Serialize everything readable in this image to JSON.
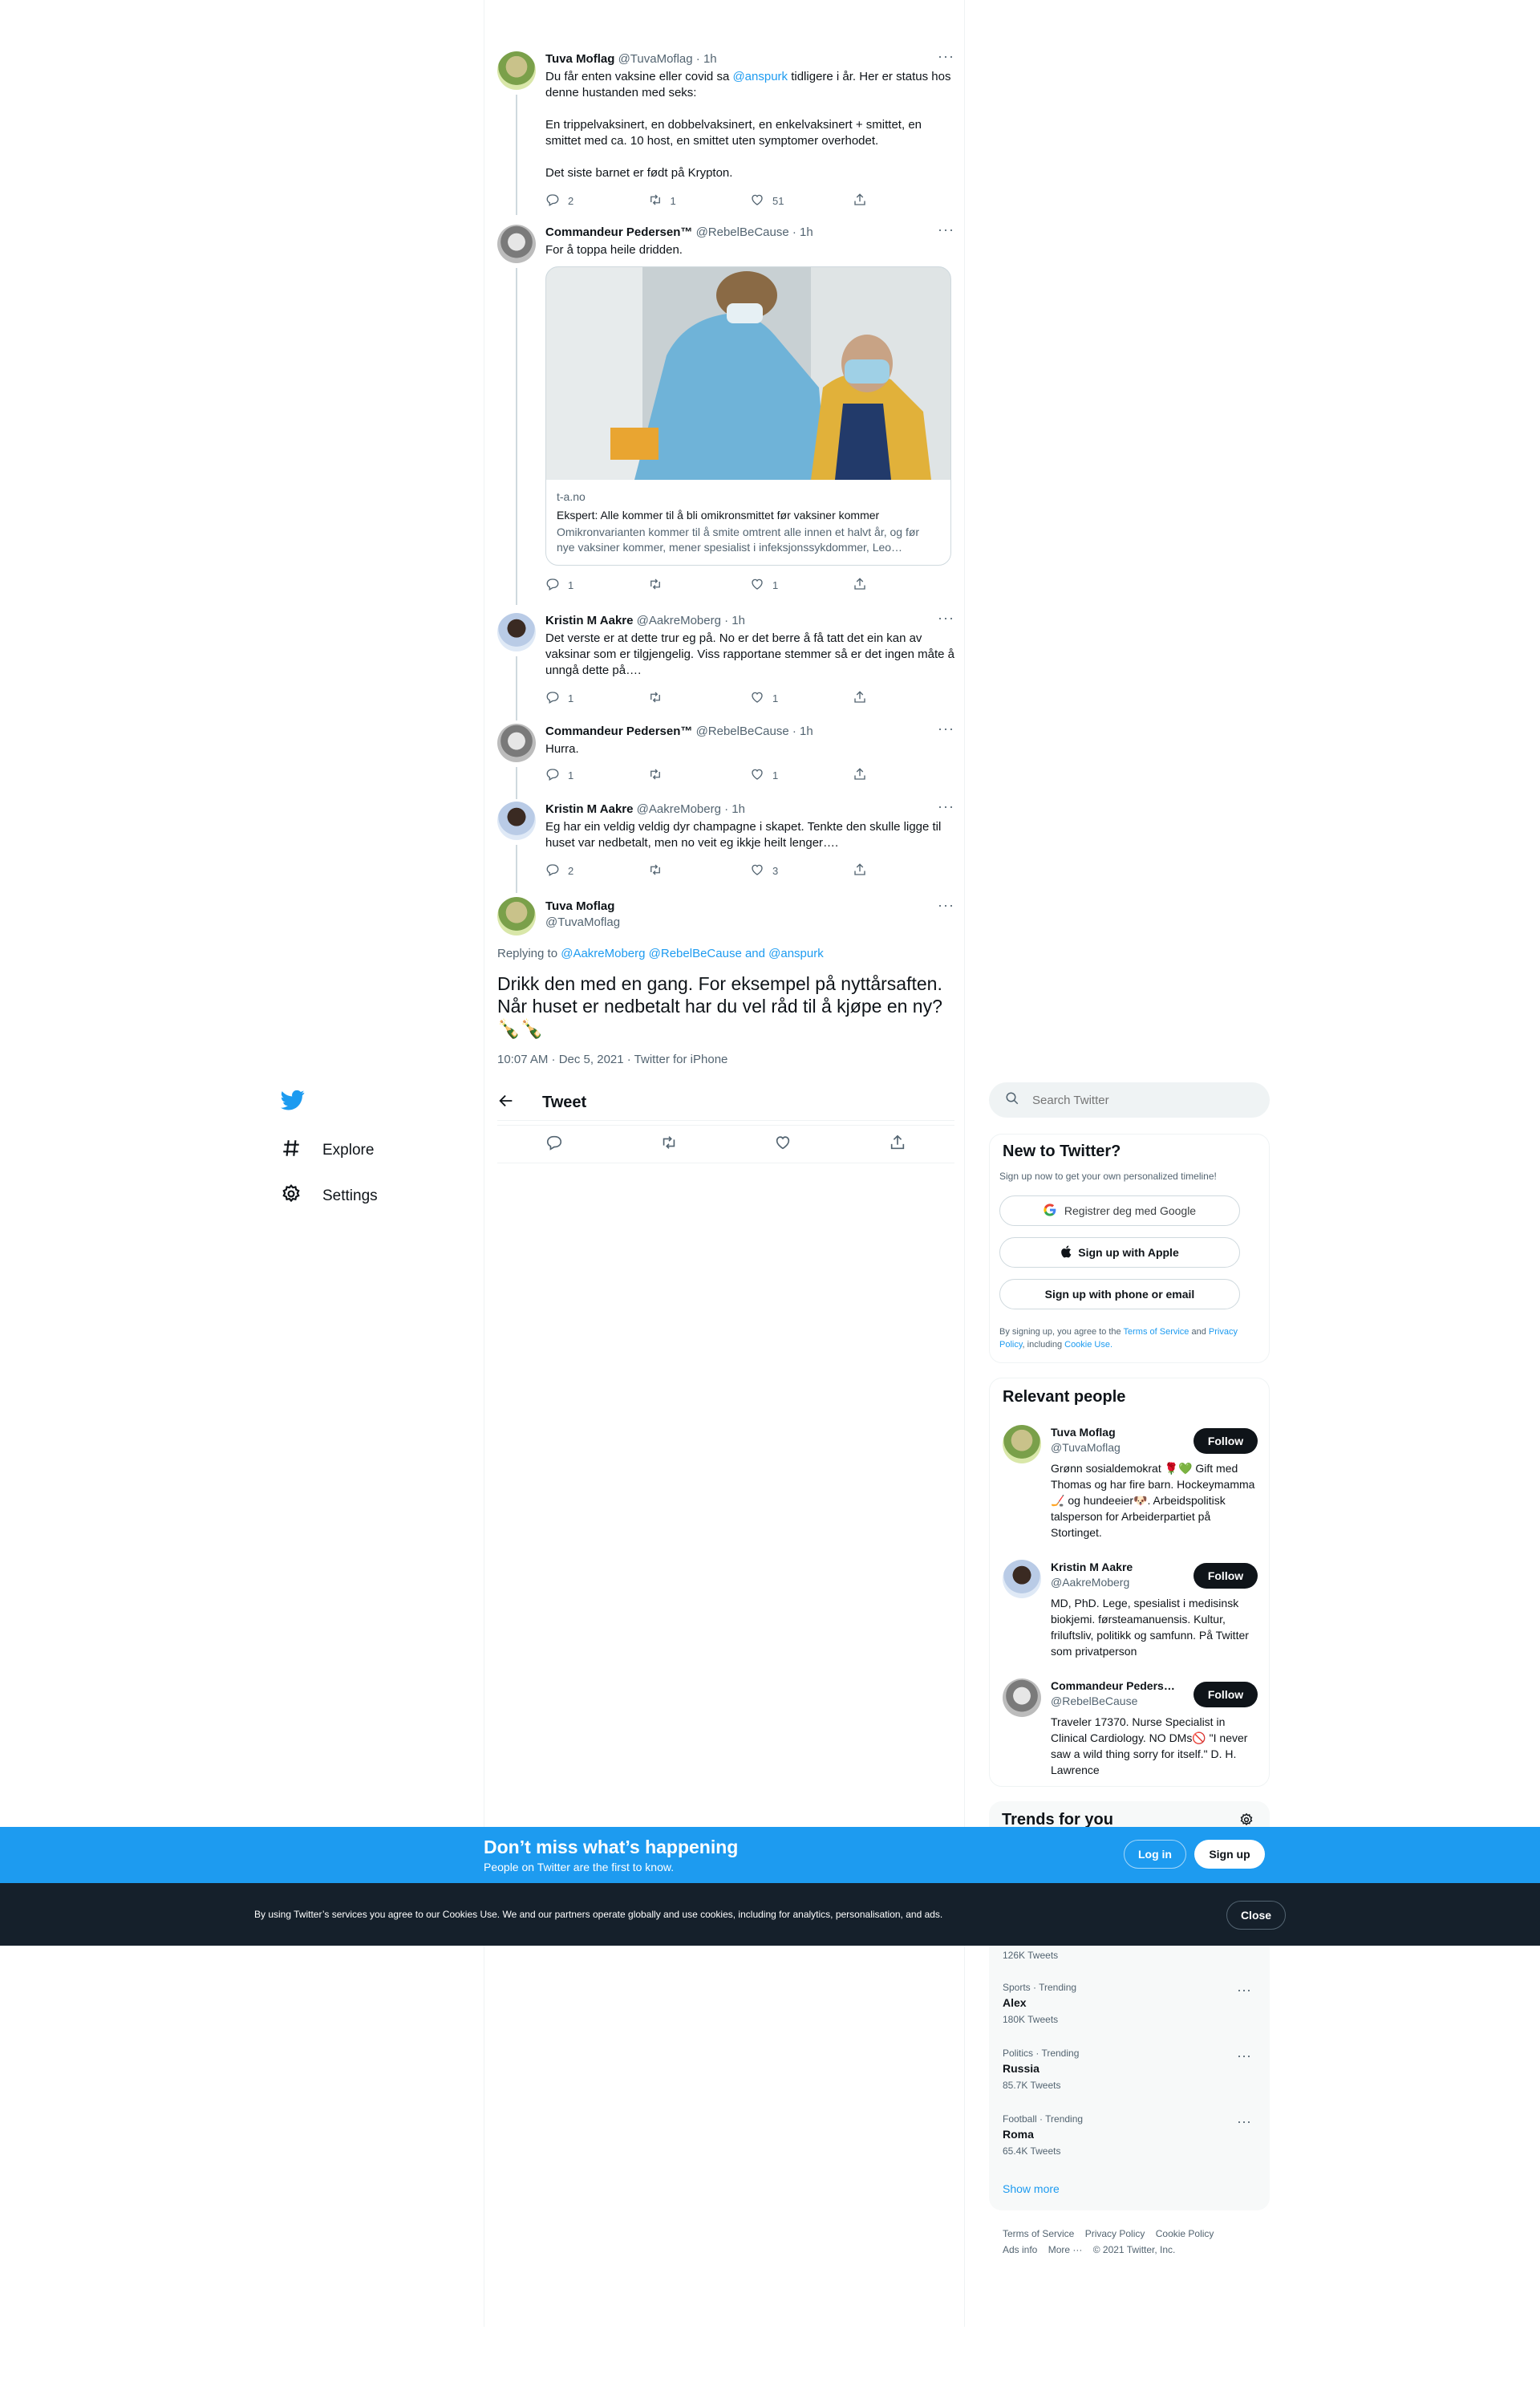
{
  "nav": {
    "explore": "Explore",
    "settings": "Settings"
  },
  "thread": [
    {
      "name": "Tuva Moflag",
      "handle": "@TuvaMoflag",
      "time": "· 1h",
      "text_pre": "Du får enten vaksine eller covid sa ",
      "mention": "@anspurk",
      "text_post": " tidligere i år. Her er status hos denne hustanden med seks:\n\nEn trippelvaksinert, en dobbelvaksinert, en enkelvaksinert + smittet, en smittet med ca. 10 host, en smittet uten symptomer overhodet.\n\nDet siste barnet er født på Krypton.",
      "replies": "2",
      "retweets": "1",
      "likes": "51"
    },
    {
      "name": "Commandeur Pedersen™",
      "handle": "@RebelBeCause",
      "time": "· 1h",
      "text": "For å toppa heile dridden.",
      "card": {
        "domain": "t-a.no",
        "title": "Ekspert: Alle kommer til å bli omikronsmittet før vaksiner kommer",
        "desc": "Omikronvarianten kommer til å smite omtrent alle innen et halvt år, og før nye vaksiner kommer, mener spesialist i infeksjonssykdommer, Leo…"
      },
      "replies": "1",
      "retweets": "",
      "likes": "1"
    },
    {
      "name": "Kristin M Aakre",
      "handle": "@AakreMoberg",
      "time": "· 1h",
      "text": "Det verste er at dette trur eg på. No er det berre å få tatt det ein kan av vaksinar som er tilgjengelig. Viss rapportane stemmer så er det ingen måte å unngå dette på….",
      "replies": "1",
      "retweets": "",
      "likes": "1"
    },
    {
      "name": "Commandeur Pedersen™",
      "handle": "@RebelBeCause",
      "time": "· 1h",
      "text": "Hurra.",
      "replies": "1",
      "retweets": "",
      "likes": "1"
    },
    {
      "name": "Kristin M Aakre",
      "handle": "@AakreMoberg",
      "time": "· 1h",
      "text": "Eg har ein veldig veldig dyr champagne i skapet. Tenkte den skulle ligge til huset var nedbetalt, men no veit eg ikkje heilt lenger….",
      "replies": "2",
      "retweets": "",
      "likes": "3"
    }
  ],
  "main": {
    "name": "Tuva Moflag",
    "handle": "@TuvaMoflag",
    "replying_label": "Replying to ",
    "replying_to": "@AakreMoberg @RebelBeCause and @anspurk",
    "text": "Drikk den med en gang. For eksempel på nyttårsaften. Når huset er nedbetalt har du vel råd til å kjøpe en ny? 🍾🍾",
    "meta": "10:07 AM · Dec 5, 2021 · Twitter for iPhone"
  },
  "header": {
    "title": "Tweet"
  },
  "search": {
    "placeholder": "Search Twitter"
  },
  "new_to_twitter": {
    "title": "New to Twitter?",
    "subtitle": "Sign up now to get your own personalized timeline!",
    "google": "Registrer deg med Google",
    "apple": "Sign up with Apple",
    "phone": "Sign up with phone or email",
    "terms_pre": "By signing up, you agree to the ",
    "terms": "Terms of Service",
    "and": " and",
    "privacy": "Privacy Policy",
    "including": ", including ",
    "cookie": "Cookie Use."
  },
  "relevant": {
    "title": "Relevant people",
    "follow": "Follow",
    "people": [
      {
        "name": "Tuva Moflag",
        "handle": "@TuvaMoflag",
        "bio": "Grønn sosialdemokrat 🌹💚 Gift med Thomas og har fire barn. Hockeymamma🏒 og hundeeier🐶. Arbeidspolitisk talsperson for Arbeiderpartiet på Stortinget."
      },
      {
        "name": "Kristin M Aakre",
        "handle": "@AakreMoberg",
        "bio": "MD, PhD. Lege, spesialist i medisinsk biokjemi. førsteamanuensis. Kultur, friluftsliv, politikk og samfunn. På Twitter som privatperson"
      },
      {
        "name": "Commandeur Peders…",
        "handle": "@RebelBeCause",
        "bio": "Traveler 17370. Nurse Specialist in Clinical Cardiology. NO DMs🚫 \"I never saw a wild thing sorry for itself.\" D. H. Lawrence"
      }
    ]
  },
  "trends": {
    "title": "Trends for you",
    "first_count": "126K Tweets",
    "items": [
      {
        "context": "Sports · Trending",
        "name": "Alex",
        "count": "180K Tweets"
      },
      {
        "context": "Politics · Trending",
        "name": "Russia",
        "count": "85.7K Tweets"
      },
      {
        "context": "Football · Trending",
        "name": "Roma",
        "count": "65.4K Tweets"
      }
    ],
    "show_more": "Show more"
  },
  "footer": {
    "terms": "Terms of Service",
    "privacy": "Privacy Policy",
    "cookie": "Cookie Policy",
    "ads": "Ads info",
    "more": "More ···",
    "copyright": "© 2021 Twitter, Inc."
  },
  "banner": {
    "title": "Don’t miss what’s happening",
    "subtitle": "People on Twitter are the first to know.",
    "login": "Log in",
    "signup": "Sign up"
  },
  "cookie": {
    "text": "By using Twitter’s services you agree to our Cookies Use. We and our partners operate globally and use cookies, including for analytics, personalisation, and ads.",
    "close": "Close"
  },
  "colors": {
    "brand": "#1d9bf0",
    "dark": "#0f1419",
    "banner_bg": "#1d9bf0",
    "cookie_bg": "#15202b"
  }
}
